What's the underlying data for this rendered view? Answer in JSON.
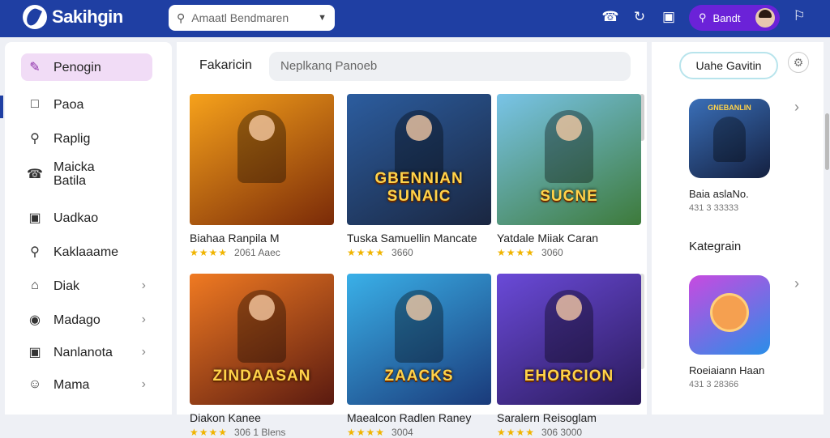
{
  "app": {
    "title": "Sakihgin"
  },
  "top_search": {
    "placeholder": "Amaatl Bendmaren"
  },
  "user": {
    "label": "Bandt"
  },
  "sidebar": {
    "items": [
      {
        "label": "Penogin",
        "icon": "pen-icon",
        "active": true
      },
      {
        "label": "Paoa",
        "icon": "square-icon"
      },
      {
        "label": "Raplig",
        "icon": "search-icon"
      },
      {
        "label": "Maicka\nBatila",
        "icon": "phone-icon"
      },
      {
        "label": "Uadkao",
        "icon": "frame-icon"
      },
      {
        "label": "Kaklaaame",
        "icon": "search-icon"
      },
      {
        "label": "Diak",
        "icon": "home-icon",
        "chevron": true
      },
      {
        "label": "Madago",
        "icon": "target-icon",
        "chevron": true
      },
      {
        "label": "Nanlanota",
        "icon": "frame-icon",
        "chevron": true
      },
      {
        "label": "Mama",
        "icon": "user-icon",
        "chevron": true
      }
    ]
  },
  "main": {
    "section_title": "Fakaricin",
    "search_placeholder": "Neplkanq Panoeb",
    "games": [
      {
        "name": "Biahaa Ranpila M",
        "rating": "2061 Aaec",
        "art_title": "",
        "colors": [
          "#f7a21b",
          "#7a2a08"
        ]
      },
      {
        "name": "Tuska Samuellin Mancate",
        "rating": "3660",
        "art_title": "GBENNIAN SUNAIC",
        "colors": [
          "#2c5d9f",
          "#1a2640"
        ]
      },
      {
        "name": "Yatdale Miiak Caran",
        "rating": "3060",
        "art_title": "SUCNE",
        "colors": [
          "#79c4e8",
          "#3d7a3a"
        ]
      },
      {
        "name": "Diakon Kanee",
        "rating": "306 1 Blens",
        "art_title": "ZINDAASAN",
        "colors": [
          "#f07a22",
          "#5a1a10"
        ]
      },
      {
        "name": "Maealcon Radlen Raney",
        "rating": "3004",
        "art_title": "ZAACKS",
        "colors": [
          "#3ab0e8",
          "#1a3a7a"
        ]
      },
      {
        "name": "Saralern Reisoglam",
        "rating": "306 3000",
        "art_title": "EHORCION",
        "colors": [
          "#6a4ad8",
          "#2a1a5a"
        ]
      }
    ]
  },
  "right": {
    "button_label": "Uahe Gavitin",
    "featured": {
      "name": "Baia aslaNo.",
      "meta": "431 3 33333",
      "art_title": "GNEBANLIN",
      "colors": [
        "#3a6fb8",
        "#142040"
      ]
    },
    "category_title": "Kategrain",
    "category_app": {
      "name": "Roeiaiann Haan",
      "meta": "431 3 28366",
      "colors": [
        "#c84ae0",
        "#2a8ee8"
      ]
    }
  },
  "colors": {
    "brand": "#1f3fa3",
    "accent": "#6b22d8",
    "active_item": "#f1dcf6",
    "star": "#f0b400"
  }
}
